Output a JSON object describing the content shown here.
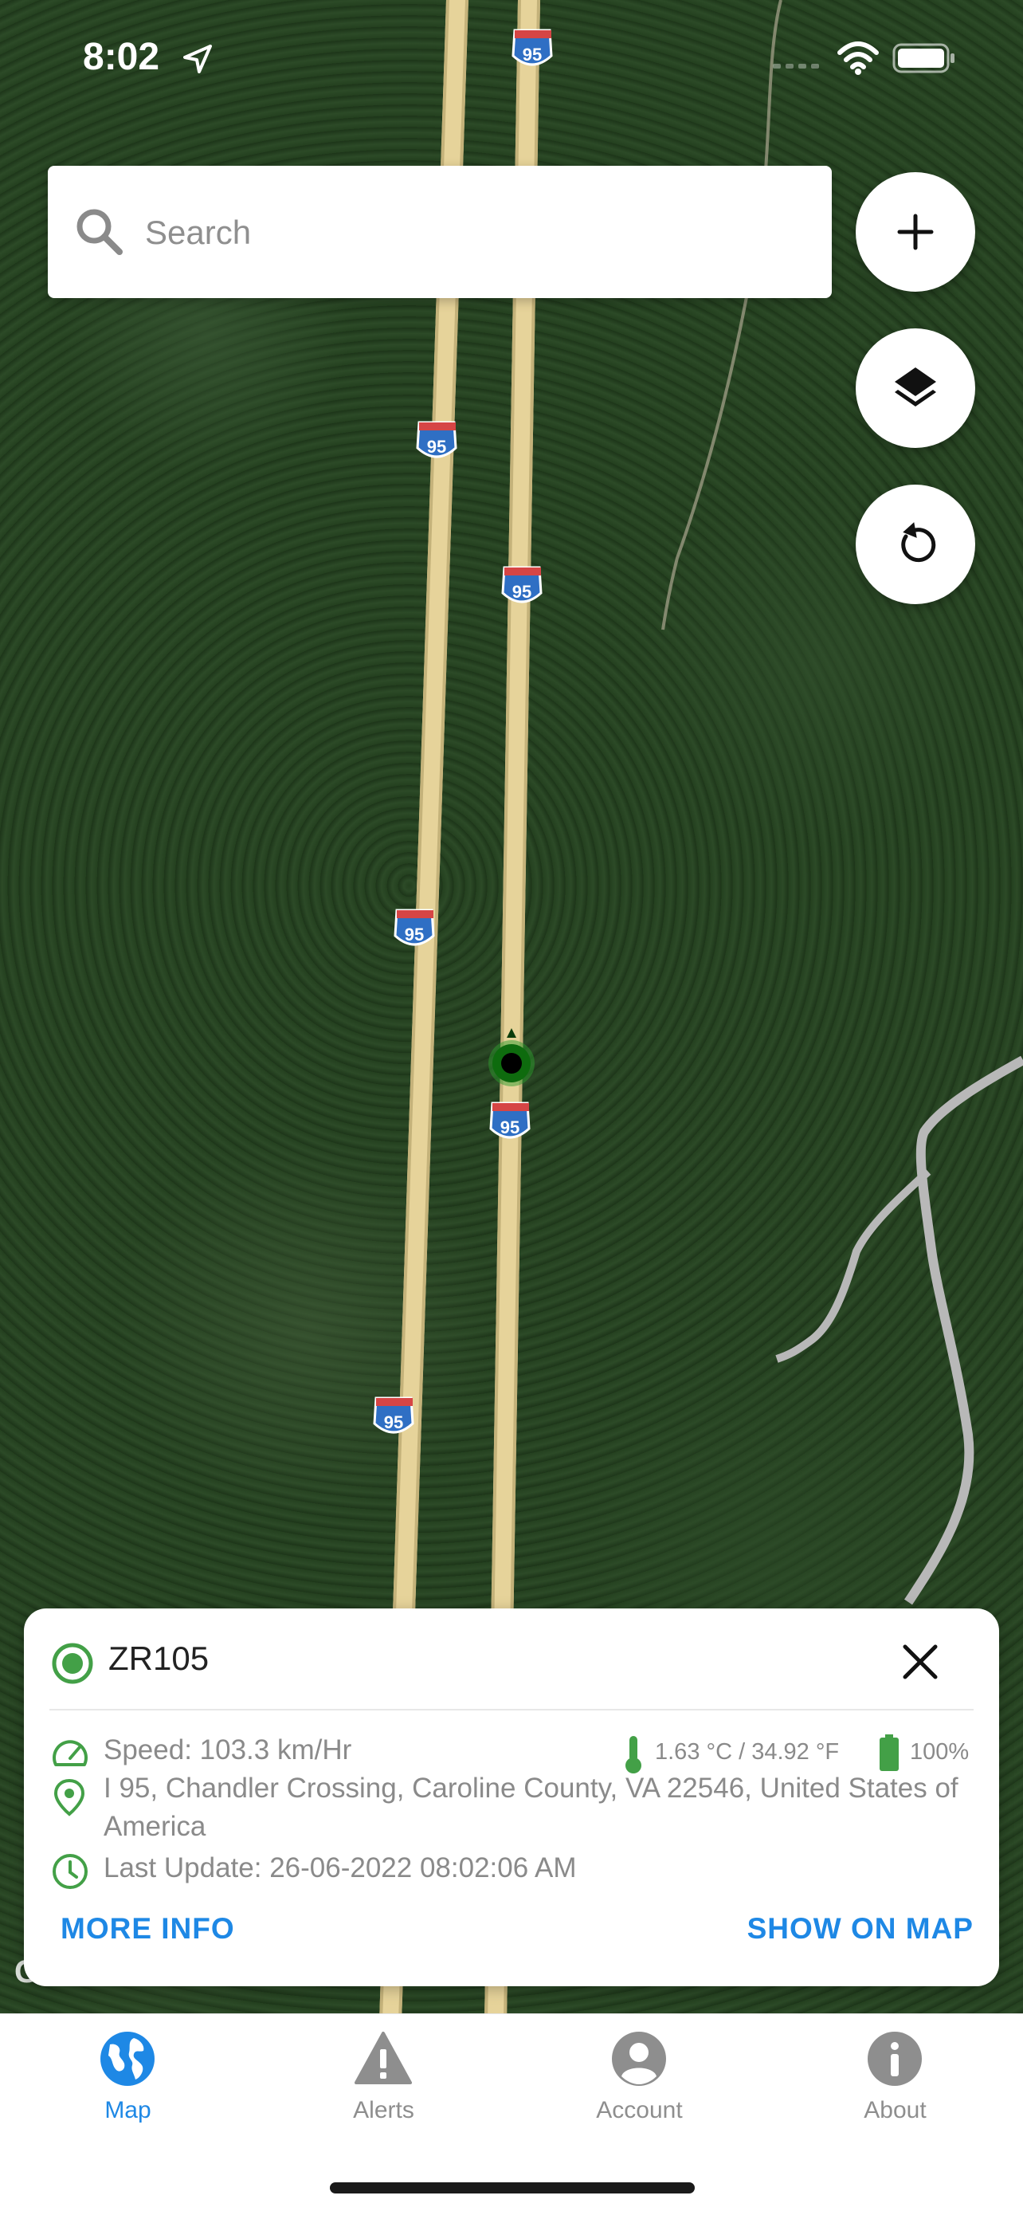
{
  "status_bar": {
    "time": "8:02",
    "location_icon": "location-arrow-icon",
    "wifi_icon": "wifi-icon",
    "battery_icon": "battery-icon"
  },
  "search": {
    "placeholder": "Search",
    "icon": "search-icon"
  },
  "map_controls": [
    {
      "name": "add-button",
      "icon": "plus-icon"
    },
    {
      "name": "layers-button",
      "icon": "layers-icon"
    },
    {
      "name": "refresh-button",
      "icon": "rotate-icon"
    }
  ],
  "map": {
    "route_shield_label": "95",
    "attribution_fragment": "G"
  },
  "vehicle_card": {
    "name": "ZR105",
    "speed": "Speed: 103.3 km/Hr",
    "temperature": "1.63 °C / 34.92 °F",
    "battery": "100%",
    "address": "I 95, Chandler Crossing, Caroline County, VA 22546, United States of America",
    "last_update": "Last Update: 26-06-2022 08:02:06 AM",
    "more_info_label": "MORE INFO",
    "show_on_map_label": "SHOW ON MAP"
  },
  "tabs": [
    {
      "label": "Map",
      "icon": "globe-icon",
      "active": true
    },
    {
      "label": "Alerts",
      "icon": "warning-icon",
      "active": false
    },
    {
      "label": "Account",
      "icon": "account-icon",
      "active": false
    },
    {
      "label": "About",
      "icon": "info-icon",
      "active": false
    }
  ],
  "colors": {
    "accent": "#1e88e5",
    "status_green": "#43a047",
    "road": "#e8d7a1",
    "shield_blue": "#2f6fc4",
    "shield_red": "#d64545"
  }
}
